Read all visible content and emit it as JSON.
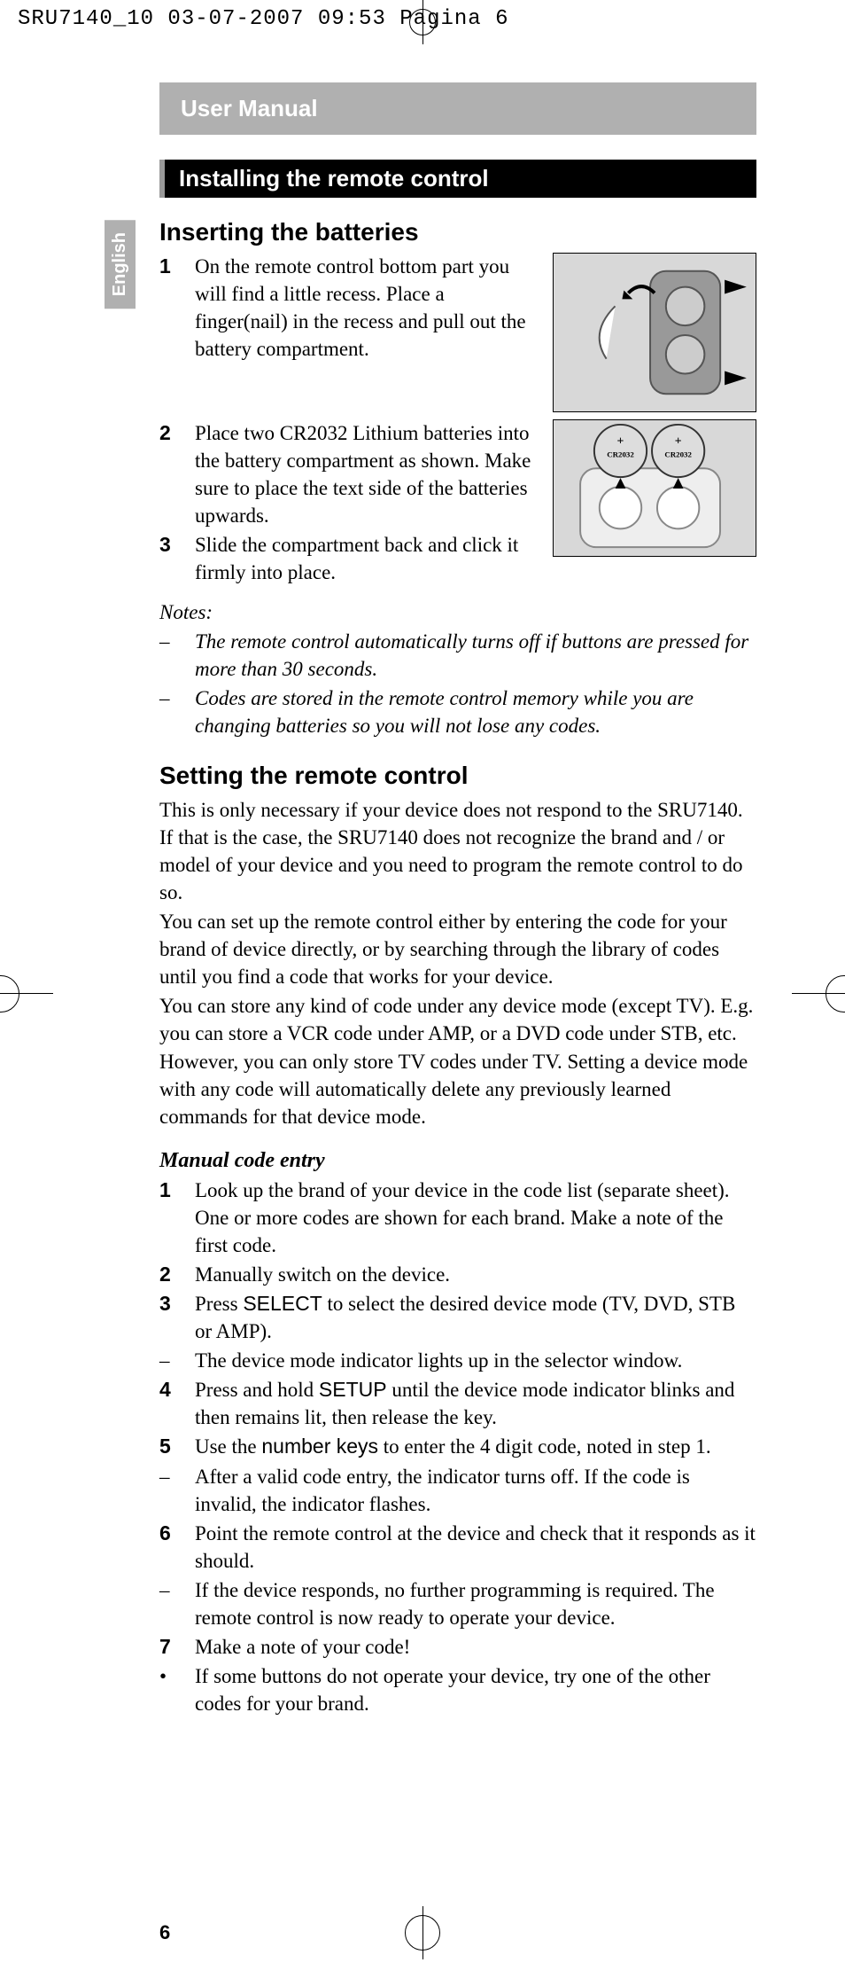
{
  "docHeader": "SRU7140_10  03-07-2007  09:53  Pagina 6",
  "langTab": "English",
  "manualHeader": "User Manual",
  "sectionBar": "Installing the remote control",
  "sub1": "Inserting the batteries",
  "steps1": {
    "s1": "On the remote control bottom part you will find a little recess. Place a finger(nail) in the recess and pull out the battery compartment.",
    "s2": "Place two CR2032 Lithium batteries into the battery compartment as shown. Make sure to place the text side of the batteries upwards.",
    "s3": "Slide the compartment back and click it firmly into place."
  },
  "notesLabel": "Notes:",
  "notes": {
    "n1": "The remote control automatically turns off if buttons are pressed for more than 30 seconds.",
    "n2": "Codes are stored in the remote control memory while you are changing batteries so you will not lose any codes."
  },
  "sub2": "Setting the remote control",
  "para2a": "This is only necessary if your device does not respond to the SRU7140. If that is the case, the SRU7140 does not recognize the brand and / or model of your device and you need to program the remote control to do so.",
  "para2b": "You can set up the remote control either by entering the code for your brand of device directly, or by searching through the library of codes until you find a code that works for your device.",
  "para2c": "You can store any kind of code under any device mode (except TV). E.g. you can store a VCR code under AMP, or a DVD code under STB, etc. However, you can only store TV codes under TV. Setting a device mode with any code will automatically delete any previously learned commands for that device mode.",
  "sub3": "Manual code entry",
  "m1": "Look up the brand of your device in the code list (separate sheet). One or more codes are shown for each brand. Make a note of the first code.",
  "m2": "Manually switch on the device.",
  "m3a": "Press ",
  "m3b": "SELECT",
  "m3c": " to select the desired device mode (TV, DVD, STB or AMP).",
  "m3dash": "The device mode indicator lights up in the selector window.",
  "m4a": "Press and hold ",
  "m4b": "SETUP",
  "m4c": " until the device mode indicator blinks and then remains lit, then release the key.",
  "m5a": "Use the ",
  "m5b": "number keys",
  "m5c": " to enter the 4 digit code, noted in step 1.",
  "m5dash": "After a valid code entry, the indicator turns off. If the code is invalid, the indicator flashes.",
  "m6": "Point the remote control at the device and check that it responds as it should.",
  "m6dash": "If the device responds, no further programming is required. The remote control is now ready to operate your device.",
  "m7": "Make a note of your code!",
  "m7bullet": "If some buttons do not operate your device, try one of the other codes for your brand.",
  "pageNum": "6",
  "fig2label1": "+ CR2032",
  "fig2label2": "+ CR2032"
}
